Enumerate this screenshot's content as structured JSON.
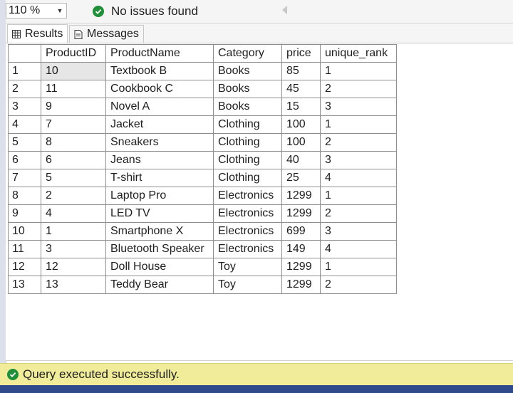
{
  "toolbar": {
    "zoom_value": "110 %",
    "issues_text": "No issues found"
  },
  "tabs": [
    {
      "label": "Results",
      "icon": "grid-icon"
    },
    {
      "label": "Messages",
      "icon": "messages-icon"
    }
  ],
  "grid": {
    "columns": [
      "",
      "ProductID",
      "ProductName",
      "Category",
      "price",
      "unique_rank"
    ],
    "rows": [
      [
        "1",
        "10",
        "Textbook B",
        "Books",
        "85",
        "1"
      ],
      [
        "2",
        "11",
        "Cookbook C",
        "Books",
        "45",
        "2"
      ],
      [
        "3",
        "9",
        "Novel A",
        "Books",
        "15",
        "3"
      ],
      [
        "4",
        "7",
        "Jacket",
        "Clothing",
        "100",
        "1"
      ],
      [
        "5",
        "8",
        "Sneakers",
        "Clothing",
        "100",
        "2"
      ],
      [
        "6",
        "6",
        "Jeans",
        "Clothing",
        "40",
        "3"
      ],
      [
        "7",
        "5",
        "T-shirt",
        "Clothing",
        "25",
        "4"
      ],
      [
        "8",
        "2",
        "Laptop Pro",
        "Electronics",
        "1299",
        "1"
      ],
      [
        "9",
        "4",
        "LED TV",
        "Electronics",
        "1299",
        "2"
      ],
      [
        "10",
        "1",
        "Smartphone X",
        "Electronics",
        "699",
        "3"
      ],
      [
        "11",
        "3",
        "Bluetooth Speaker",
        "Electronics",
        "149",
        "4"
      ],
      [
        "12",
        "12",
        "Doll House",
        "Toy",
        "1299",
        "1"
      ],
      [
        "13",
        "13",
        "Teddy Bear",
        "Toy",
        "1299",
        "2"
      ]
    ]
  },
  "status": {
    "text": "Query executed successfully.",
    "color": "#f0ec9a"
  },
  "colors": {
    "success_green": "#1f8f3a",
    "selected_cell": "#e6e6e6"
  }
}
